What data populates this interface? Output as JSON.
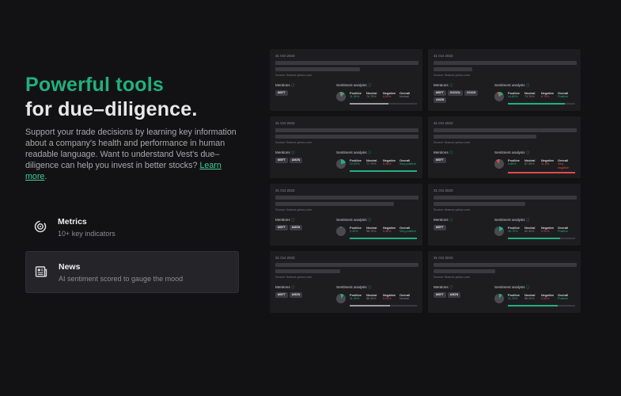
{
  "hero": {
    "title_green": "Powerful tools",
    "title_white": "for due–diligence.",
    "description": "Support your trade decisions by learning key information about a company's health and performance in human readable language. Want to understand Vest's due–diligence can help you invest in better stocks?",
    "link": "Learn more",
    "period": "."
  },
  "features": [
    {
      "title": "Metrics",
      "subtitle": "10+ key indicators",
      "icon": "target-icon",
      "active": false
    },
    {
      "title": "News",
      "subtitle": "AI sentiment scored to gauge the mood",
      "icon": "newspaper-icon",
      "active": true
    }
  ],
  "labels": {
    "mentions": "Mentions",
    "sentiment": "Sentiment analysis",
    "positive": "Positive",
    "neutral": "Neutral",
    "negative": "Negative",
    "overall": "Overall",
    "info_icon": "ⓘ"
  },
  "colors": {
    "positive": "#22b07d",
    "negative": "#e24a4a",
    "neutral": "#8a8a8f",
    "accent": "#22b07d"
  },
  "cards": [
    {
      "date": "31 Oct 2023",
      "source": "Source: finance.yahoo.com",
      "bar2": 107,
      "chips": [
        "MSFT"
      ],
      "positive": "11.90%",
      "neutral": "74.70%",
      "negative": "5.00%",
      "overall": "Neutral",
      "overall_color": "neutral",
      "pie": [
        12,
        75,
        5
      ],
      "fill": 0.58,
      "fill_color": "neutral"
    },
    {
      "date": "31 Oct 2023",
      "source": "Source: finance.yahoo.com",
      "bar2": 49,
      "chips": [
        "MSFT",
        "GOOGL",
        "GOOG",
        "AMZN"
      ],
      "positive": "14.60%",
      "neutral": "74.70%",
      "negative": "6.70%",
      "overall": "Positive",
      "overall_color": "positive",
      "pie": [
        15,
        75,
        7
      ],
      "fill": 0.85,
      "fill_color": "positive"
    },
    {
      "date": "31 Oct 2023",
      "source": "Source: finance.yahoo.com",
      "bar2": 181,
      "chips": [
        "MSFT",
        "AMZN"
      ],
      "positive": "22.00%",
      "neutral": "77.70%",
      "negative": "0.40%",
      "overall": "Very positive",
      "overall_color": "positive",
      "pie": [
        22,
        78,
        0
      ],
      "fill": 1.0,
      "fill_color": "positive"
    },
    {
      "date": "31 Oct 2023",
      "source": "Source: finance.yahoo.com",
      "bar2": 130,
      "chips": [
        "MSFT"
      ],
      "positive": "0.80%",
      "neutral": "87.90%",
      "negative": "11.0%",
      "overall": "Very negative",
      "overall_color": "negative",
      "pie": [
        1,
        88,
        11
      ],
      "fill": 1.0,
      "fill_color": "negative"
    },
    {
      "date": "31 Oct 2023",
      "source": "Source: finance.yahoo.com",
      "bar2": 150,
      "chips": [
        "MSFT",
        "AMZN"
      ],
      "positive": "0.40%",
      "neutral": "98.70%",
      "negative": "0.40%",
      "overall": "Very positive",
      "overall_color": "positive",
      "pie": [
        1,
        98,
        1
      ],
      "fill": 1.0,
      "fill_color": "positive"
    },
    {
      "date": "31 Oct 2023",
      "source": "Source: finance.yahoo.com",
      "bar2": 116,
      "chips": [
        "MSFT"
      ],
      "positive": "16.70%",
      "neutral": "82.30%",
      "negative": "0.00%",
      "overall": "Positive",
      "overall_color": "positive",
      "pie": [
        17,
        83,
        0
      ],
      "fill": 0.78,
      "fill_color": "positive"
    },
    {
      "date": "31 Oct 2023",
      "source": "Source: finance.yahoo.com",
      "bar2": 82,
      "chips": [
        "MSFT",
        "AMZN"
      ],
      "positive": "11.40%",
      "neutral": "88.30%",
      "negative": "0.20%",
      "overall": "Neutral",
      "overall_color": "neutral",
      "pie": [
        11,
        88,
        1
      ],
      "fill": 0.6,
      "fill_color": "neutral"
    },
    {
      "date": "31 Oct 2023",
      "source": "Source: finance.yahoo.com",
      "bar2": 78,
      "chips": [
        "MSFT",
        "AMZN"
      ],
      "positive": "11.20%",
      "neutral": "88.30%",
      "negative": "0.00%",
      "overall": "Positive",
      "overall_color": "positive",
      "pie": [
        11,
        88,
        0
      ],
      "fill": 0.74,
      "fill_color": "positive"
    }
  ]
}
